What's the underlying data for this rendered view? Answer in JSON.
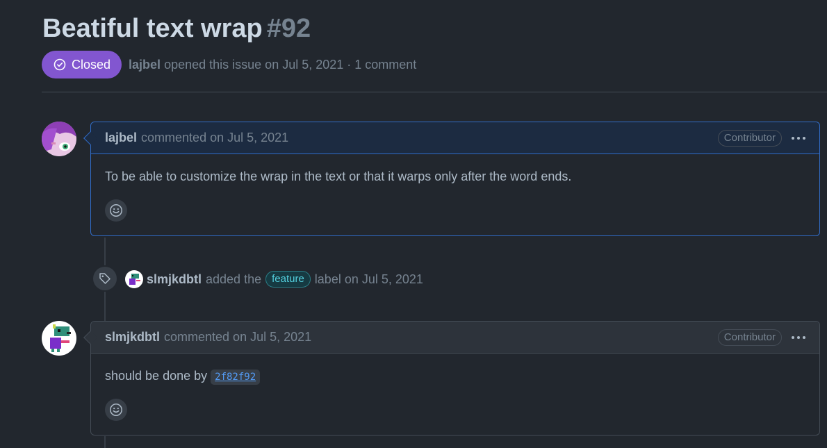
{
  "issue": {
    "title": "Beatiful text wrap",
    "number": "#92",
    "state": "Closed",
    "author": "lajbel",
    "meta": "opened this issue on Jul 5, 2021 · 1 comment"
  },
  "comments": [
    {
      "author": "lajbel",
      "action": "commented on Jul 5, 2021",
      "role": "Contributor",
      "body": "To be able to customize the wrap in the text or that it warps only after the word ends."
    },
    {
      "author": "slmjkdbtl",
      "action": "commented on Jul 5, 2021",
      "role": "Contributor",
      "body_prefix": "should be done by",
      "commit": "2f82f92"
    }
  ],
  "event": {
    "author": "slmjkdbtl",
    "text_before": "added the",
    "label": "feature",
    "text_after": "label on Jul 5, 2021"
  },
  "colors": {
    "background": "#22272e",
    "closed_badge": "#8256d0",
    "author_border": "#316dca",
    "label_text": "#54d0de"
  },
  "icons": {
    "state": "check-circle-icon",
    "event": "tag-icon",
    "reaction": "smiley-icon",
    "menu": "kebab-horizontal-icon"
  }
}
